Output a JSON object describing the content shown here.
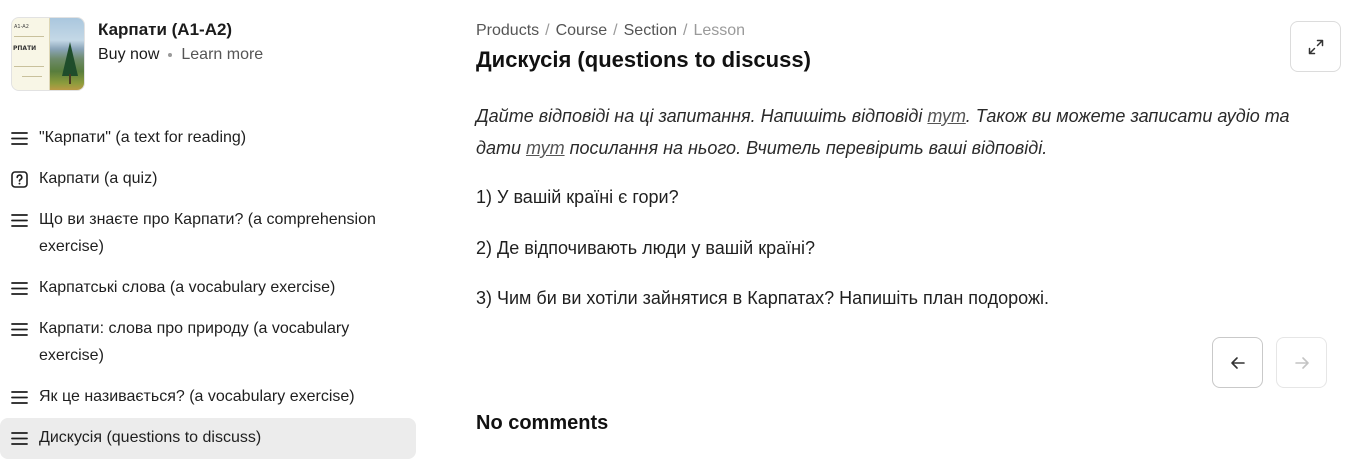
{
  "product": {
    "cover_level": "A1-A2",
    "cover_name": "РПАТИ",
    "title": "Карпати (A1-A2)",
    "buy_label": "Buy now",
    "learn_label": "Learn more"
  },
  "sidebar": {
    "items": [
      {
        "label": "\"Карпати\" (a text for reading)",
        "icon": "list-icon",
        "active": false
      },
      {
        "label": "Карпати (a quiz)",
        "icon": "quiz-icon",
        "active": false
      },
      {
        "label": "Що ви знаєте про Карпати? (a comprehension exercise)",
        "icon": "list-icon",
        "active": false
      },
      {
        "label": "Карпатські слова (a vocabulary exercise)",
        "icon": "list-icon",
        "active": false
      },
      {
        "label": "Карпати: слова про природу (a vocabulary exercise)",
        "icon": "list-icon",
        "active": false
      },
      {
        "label": "Як це називається? (a vocabulary exercise)",
        "icon": "list-icon",
        "active": false
      },
      {
        "label": "Дискусія (questions to discuss)",
        "icon": "list-icon",
        "active": true
      }
    ]
  },
  "breadcrumb": {
    "items": [
      "Products",
      "Course",
      "Section",
      "Lesson"
    ]
  },
  "main": {
    "title": "Дискусія (questions to discuss)",
    "intro_part1": "Дайте відповіді на ці запитання. Напишіть відповіді ",
    "intro_link1": "тут",
    "intro_part2": ". Також ви можете записати аудіо та дати ",
    "intro_link2": "тут",
    "intro_part3": " посилання на нього. Вчитель перевірить ваші відповіді.",
    "questions": [
      "1) У вашій країні є гори?",
      "2) Де відпочивають люди у вашій країні?",
      "3) Чим би ви хотіли зайнятися в Карпатах? Напишіть план подорожі."
    ],
    "comments_label": "No comments"
  },
  "colors": {
    "active_item_bg": "#ececec",
    "text": "#1f1f1f",
    "muted": "#9a9a9a"
  }
}
